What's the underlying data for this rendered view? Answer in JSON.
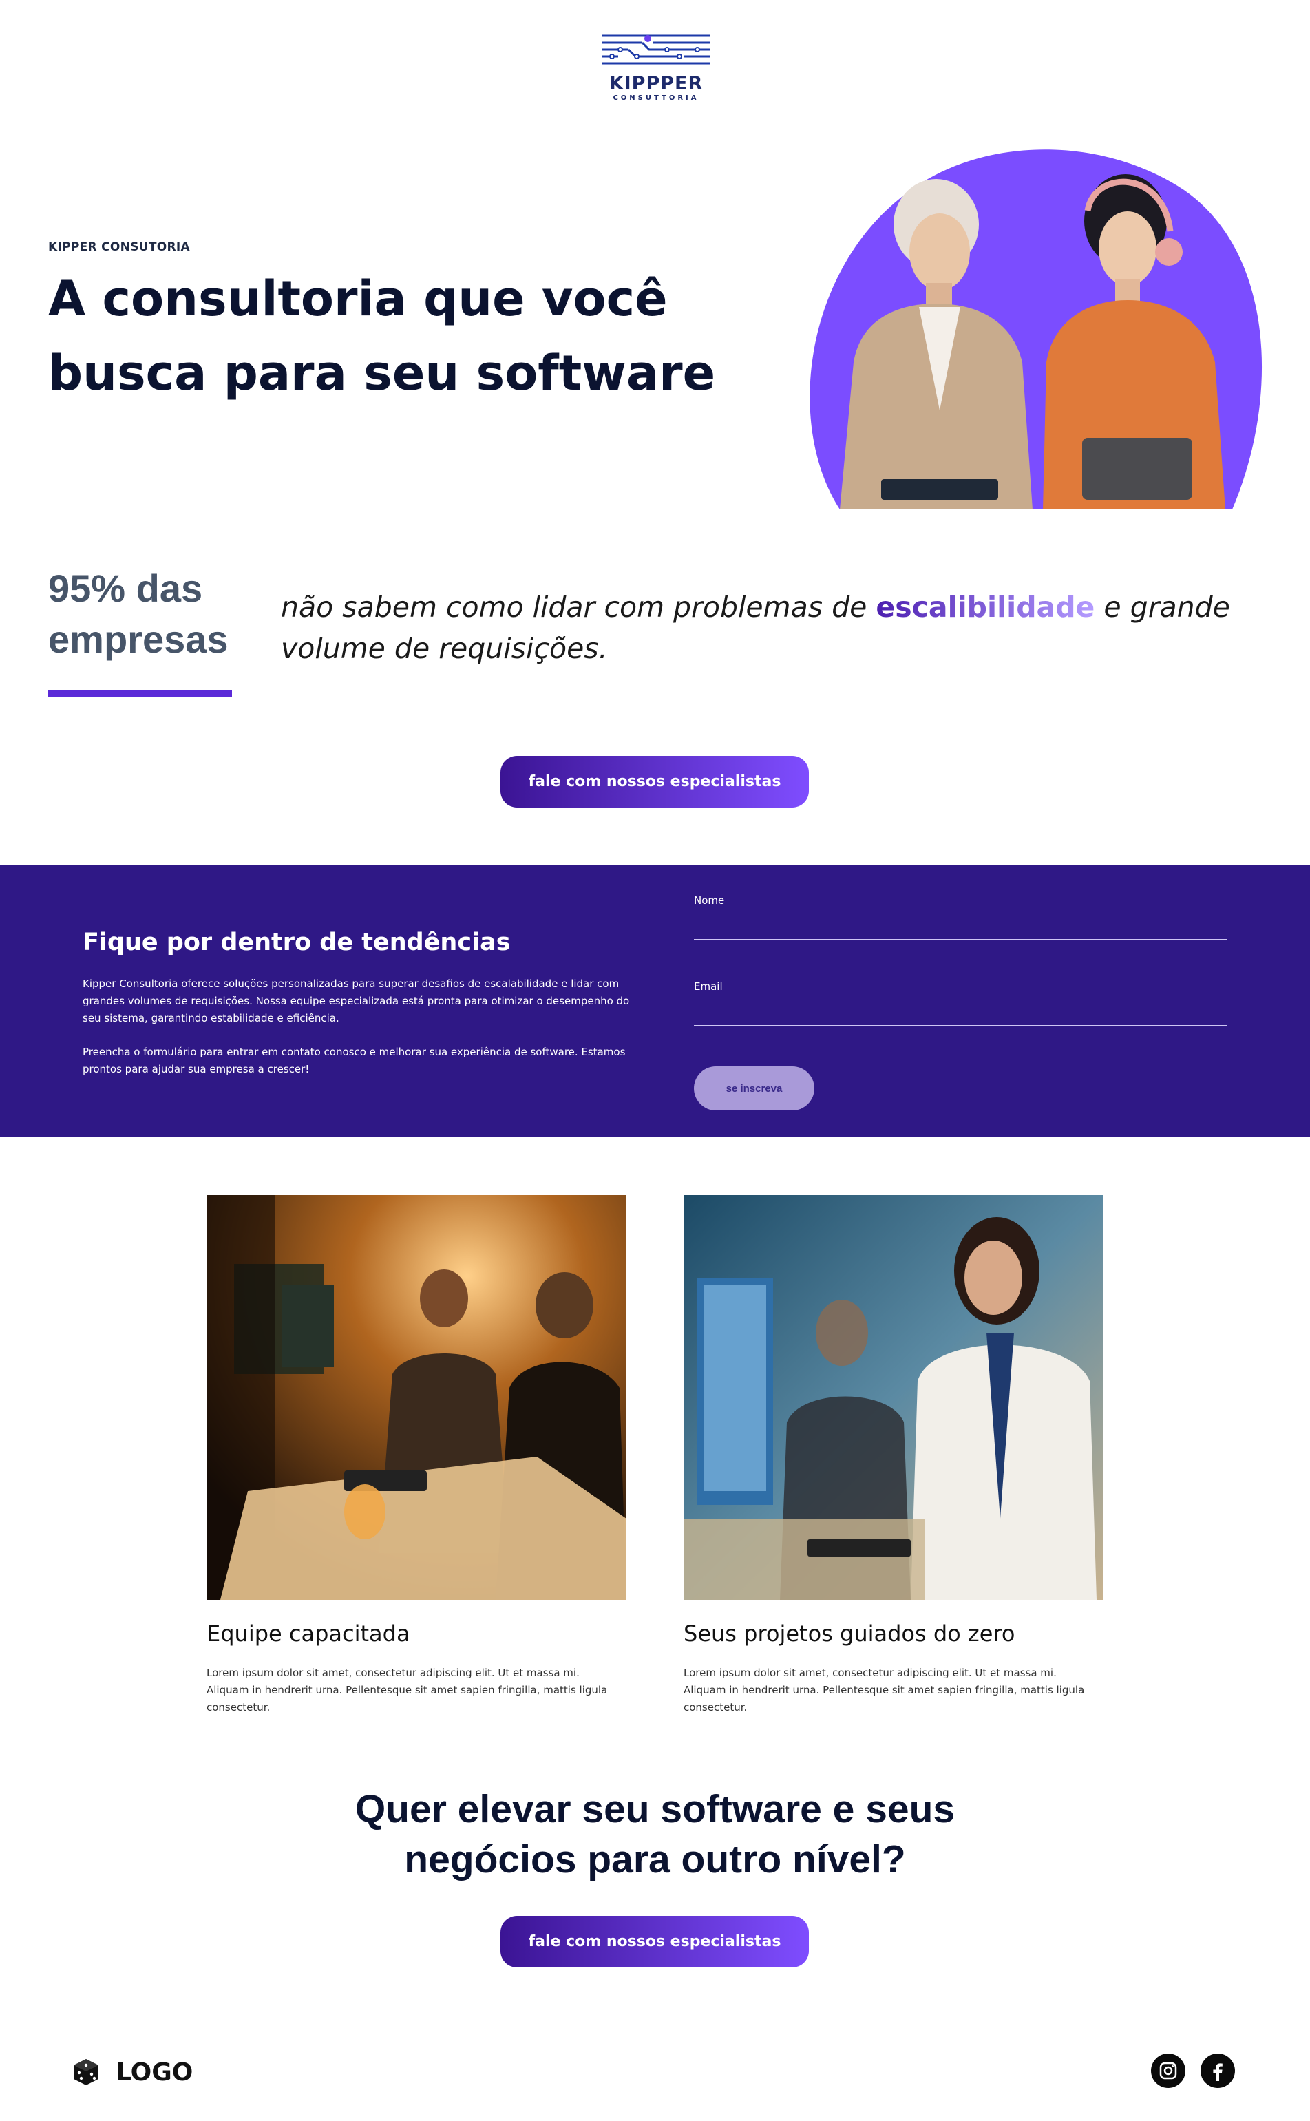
{
  "brand": {
    "logo_name": "KIPPPER",
    "logo_sub": "CONSUTTORIA"
  },
  "hero": {
    "eyebrow": "KIPPER CONSUTORIA",
    "title": "A consultoria que você busca para seu software"
  },
  "stat": {
    "headline": "95% das empresas",
    "text_before": "não sabem como lidar com problemas de ",
    "highlight": "escalibilidade",
    "text_after": " e grande volume de requisições."
  },
  "cta": {
    "primary_label": "fale com nossos especialistas",
    "closing_label": "fale com nossos especialistas"
  },
  "newsletter": {
    "title": "Fique por dentro de tendências",
    "paragraph_1": "Kipper Consultoria oferece soluções personalizadas para superar desafios de escalabilidade e lidar com grandes volumes de requisições. Nossa equipe especializada está pronta para otimizar o desempenho do seu sistema, garantindo estabilidade e eficiência.",
    "paragraph_2": "Preencha o formulário para entrar em contato conosco e melhorar sua experiência de software. Estamos prontos para ajudar sua empresa a crescer!",
    "name_label": "Nome",
    "name_value": "",
    "email_label": "Email",
    "email_value": "",
    "submit_label": "se inscreva"
  },
  "features": [
    {
      "title": "Equipe capacitada",
      "text": "Lorem ipsum dolor sit amet, consectetur adipiscing elit. Ut et massa mi. Aliquam in hendrerit urna. Pellentesque sit amet sapien fringilla, mattis ligula consectetur."
    },
    {
      "title": "Seus projetos guiados do zero",
      "text": "Lorem ipsum dolor sit amet, consectetur adipiscing elit. Ut et massa mi. Aliquam in hendrerit urna. Pellentesque sit amet sapien fringilla, mattis ligula consectetur."
    }
  ],
  "closing": {
    "title": "Quer elevar seu software e seus negócios para outro nível?"
  },
  "footer": {
    "logo_text": "LOGO",
    "logo_icon": "cube-icon",
    "socials": [
      "instagram-icon",
      "facebook-icon"
    ]
  },
  "colors": {
    "accent": "#5b2ad8",
    "newsletter_bg": "#2f1886",
    "cta_gradient_start": "#3b1494",
    "cta_gradient_end": "#7f4dff",
    "hero_circle": "#7b4dff"
  }
}
